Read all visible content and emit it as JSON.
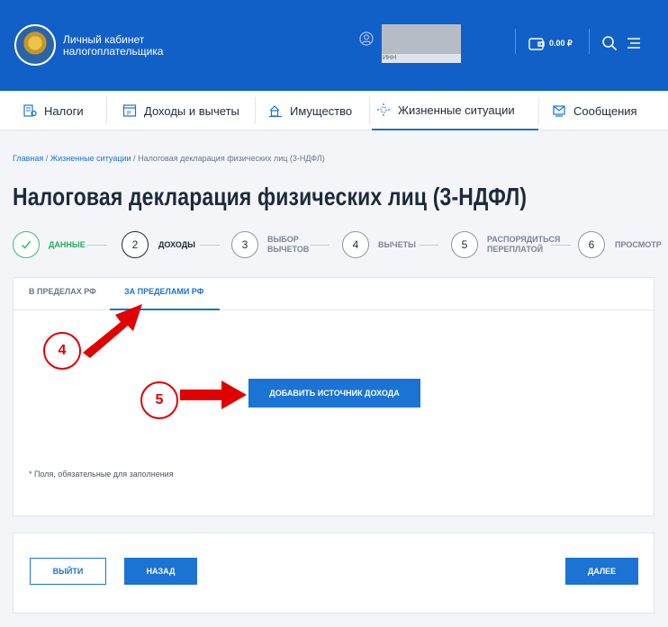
{
  "header": {
    "logo_title": "Личный кабинет налогоплательщика",
    "user_inn_label": "ИНН",
    "balance": "0.00 ₽"
  },
  "nav": {
    "items": [
      {
        "label": "Налоги",
        "icon": "tax-icon"
      },
      {
        "label": "Доходы и вычеты",
        "icon": "income-icon"
      },
      {
        "label": "Имущество",
        "icon": "property-icon"
      },
      {
        "label": "Жизненные ситуации",
        "icon": "life-situations-icon"
      },
      {
        "label": "Сообщения",
        "icon": "messages-icon"
      }
    ],
    "active": "Жизненные ситуации"
  },
  "breadcrumb": {
    "home": "Главная",
    "sep1": "/",
    "section": "Жизненные ситуации",
    "sep2": "/",
    "current": "Налоговая декларация физических лиц (3-НДФЛ)"
  },
  "page": {
    "title": "Налоговая декларация физических лиц (3-НДФЛ)"
  },
  "stepper": {
    "steps": [
      {
        "number": "✓",
        "label": "Данные",
        "state": "done"
      },
      {
        "number": "2",
        "label": "Доходы",
        "state": "active"
      },
      {
        "number": "3",
        "label_line1": "Выбор",
        "label_line2": "вычетов",
        "state": "pending"
      },
      {
        "number": "4",
        "label": "Вычеты",
        "state": "pending"
      },
      {
        "number": "5",
        "label_line1": "Распорядиться",
        "label_line2": "переплатой",
        "state": "pending"
      },
      {
        "number": "6",
        "label": "Просмотр",
        "state": "pending"
      }
    ]
  },
  "tabs": {
    "items": [
      {
        "label": "В пределах РФ"
      },
      {
        "label": "За пределами РФ"
      }
    ],
    "active": "За пределами РФ"
  },
  "content": {
    "add_source_button": "Добавить источник дохода",
    "required_note": "* Поля, обязательные для заполнения"
  },
  "annotations": {
    "marker_4": "4",
    "marker_5": "5",
    "color": "#e00000"
  },
  "footer": {
    "exit_button": "Выйти",
    "back_button": "Назад",
    "next_button": "Далее"
  },
  "colors": {
    "header_bg": "#1160c8",
    "primary": "#1b73d3",
    "success": "#3cbf6e"
  }
}
